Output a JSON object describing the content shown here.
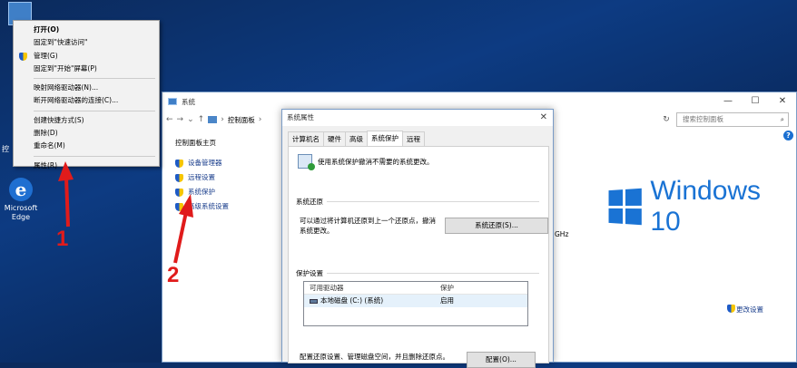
{
  "desktop": {
    "edge_label_line1": "Microsoft",
    "edge_label_line2": "Edge",
    "partial_label": "控"
  },
  "context_menu": {
    "items": [
      {
        "label": "打开(O)",
        "bold": true
      },
      {
        "label": "固定到\"快速访问\""
      },
      {
        "label": "管理(G)",
        "shield": true
      },
      {
        "label": "固定到\"开始\"屏幕(P)"
      },
      {
        "label": "映射网络驱动器(N)..."
      },
      {
        "label": "断开网络驱动器的连接(C)..."
      },
      {
        "label": "创建快捷方式(S)"
      },
      {
        "label": "删除(D)"
      },
      {
        "label": "重命名(M)"
      },
      {
        "label": "属性(R)"
      }
    ]
  },
  "system_window": {
    "title": "系统",
    "breadcrumb": "控制面板",
    "search_placeholder": "搜索控制面板",
    "nav_home": "控制面板主页",
    "nav_links": [
      "设备管理器",
      "远程设置",
      "系统保护",
      "高级系统设置"
    ],
    "brand": "Windows 10",
    "ghz_fragment": "GHz",
    "change_settings": "更改设置",
    "controls": {
      "minimize": "—",
      "maximize": "☐",
      "close": "✕"
    }
  },
  "dialog": {
    "title": "系统属性",
    "tabs": [
      "计算机名",
      "硬件",
      "高级",
      "系统保护",
      "远程"
    ],
    "active_tab": "系统保护",
    "intro": "使用系统保护撤消不需要的系统更改。",
    "restore_group": "系统还原",
    "restore_text_line1": "可以通过将计算机还原到上一个还原点，撤消",
    "restore_text_line2": "系统更改。",
    "restore_button": "系统还原(S)...",
    "protection_group": "保护设置",
    "list_headers": [
      "可用驱动器",
      "保护"
    ],
    "list_rows": [
      {
        "drive": "本地磁盘 (C:) (系统)",
        "protection": "启用"
      }
    ],
    "config_text": "配置还原设置、管理磁盘空间，并且删除还原点。",
    "config_button": "配置(O)..."
  },
  "annotations": {
    "step1": "1",
    "step2": "2",
    "color": "#e01b1b"
  }
}
